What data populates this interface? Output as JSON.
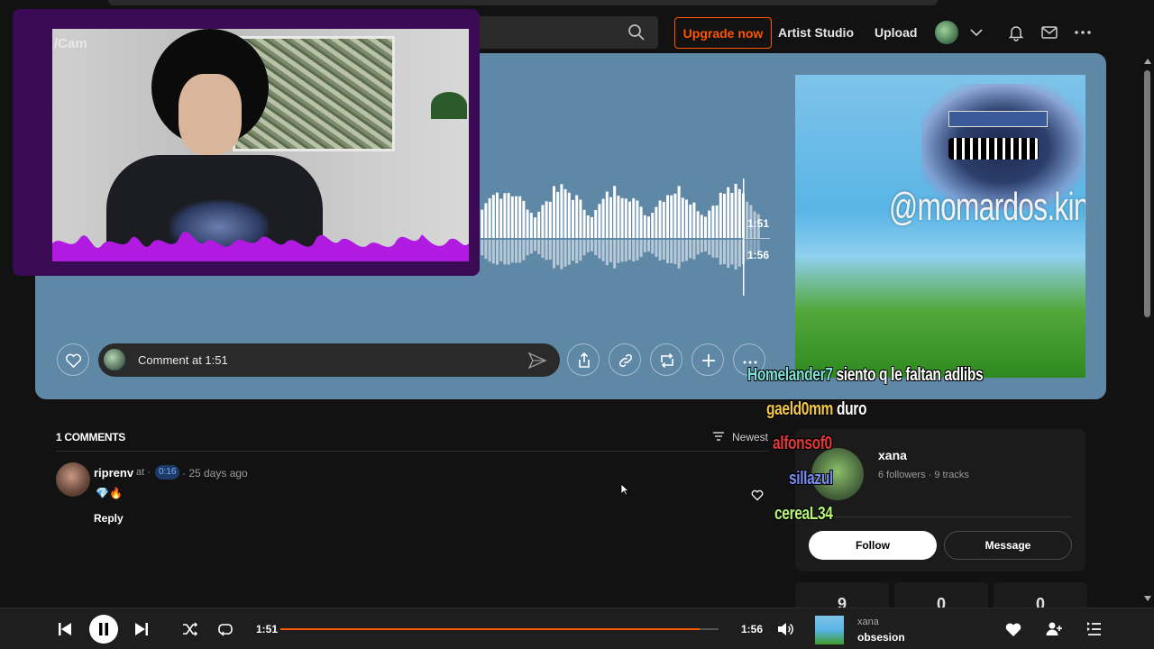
{
  "header": {
    "upgrade_label": "Upgrade now",
    "artist_studio_label": "Artist Studio",
    "upload_label": "Upload"
  },
  "track": {
    "current_time": "1:51",
    "duration": "1:56",
    "played_fraction": 0.957
  },
  "actions": {
    "comment_placeholder": "Comment at 1:51"
  },
  "webcam": {
    "label": "/Cam"
  },
  "artwork": {
    "watermark": "@momardos.kinoto"
  },
  "comments": {
    "header": "1 COMMENTS",
    "sort_label": "Newest",
    "items": [
      {
        "user": "riprenv",
        "at": "at ·",
        "timestamp": "0:16",
        "ago": "· 25 days ago",
        "body": "💎🔥",
        "reply_label": "Reply"
      }
    ]
  },
  "artist": {
    "name": "xana",
    "stats": "6 followers · 9 tracks",
    "follow_label": "Follow",
    "message_label": "Message",
    "stat_values": [
      "9",
      "0",
      "0"
    ]
  },
  "chat": [
    {
      "user": "Homelander7",
      "msg": "siento q le faltan adlibs",
      "color": "#7fe0d6"
    },
    {
      "user": "gaeld0mm",
      "msg": "duro",
      "color": "#f3c84a"
    },
    {
      "user": "alfonsof0",
      "msg": "",
      "color": "#e23a3a"
    },
    {
      "user": "sillazul",
      "msg": "",
      "color": "#7a8cf0"
    },
    {
      "user": "cereaL34",
      "msg": "",
      "color": "#b9f37a"
    }
  ],
  "player": {
    "artist": "xana",
    "track": "obsesion",
    "current_time": "1:51",
    "duration": "1:56"
  },
  "colors": {
    "accent": "#ff5500",
    "hero_bg": "#5f87a6"
  }
}
